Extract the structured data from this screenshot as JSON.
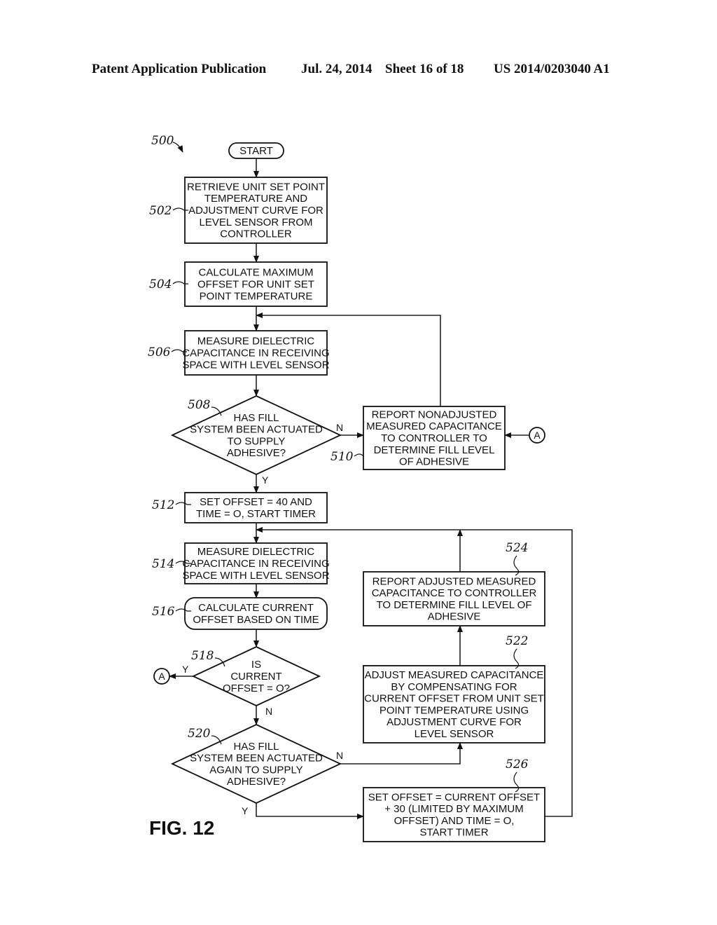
{
  "header": {
    "publication": "Patent Application Publication",
    "date": "Jul. 24, 2014",
    "sheet": "Sheet 16 of 18",
    "number": "US 2014/0203040 A1"
  },
  "figure": {
    "label": "FIG. 12",
    "ref": "500"
  },
  "nodes": [
    {
      "id": "start",
      "ref": "",
      "type": "terminal",
      "lines": [
        "START"
      ]
    },
    {
      "id": "502",
      "ref": "502",
      "type": "process",
      "lines": [
        "RETRIEVE UNIT SET POINT",
        "TEMPERATURE AND",
        "ADJUSTMENT CURVE FOR",
        "LEVEL SENSOR FROM",
        "CONTROLLER"
      ]
    },
    {
      "id": "504",
      "ref": "504",
      "type": "process",
      "lines": [
        "CALCULATE MAXIMUM",
        "OFFSET FOR UNIT SET",
        "POINT TEMPERATURE"
      ]
    },
    {
      "id": "506",
      "ref": "506",
      "type": "process",
      "lines": [
        "MEASURE DIELECTRIC",
        "CAPACITANCE IN RECEIVING",
        "SPACE WITH LEVEL SENSOR"
      ]
    },
    {
      "id": "508",
      "ref": "508",
      "type": "decision",
      "lines": [
        "HAS FILL",
        "SYSTEM BEEN ACTUATED",
        "TO SUPPLY",
        "ADHESIVE?"
      ]
    },
    {
      "id": "510",
      "ref": "510",
      "type": "process",
      "lines": [
        "REPORT  NONADJUSTED",
        "MEASURED CAPACITANCE",
        "TO CONTROLLER TO",
        "DETERMINE FILL LEVEL",
        "OF ADHESIVE"
      ]
    },
    {
      "id": "512",
      "ref": "512",
      "type": "process",
      "lines": [
        "SET OFFSET = 40 AND",
        "TIME = O, START TIMER"
      ]
    },
    {
      "id": "514",
      "ref": "514",
      "type": "process",
      "lines": [
        "MEASURE DIELECTRIC",
        "CAPACITANCE IN RECEIVING",
        "SPACE WITH LEVEL SENSOR"
      ]
    },
    {
      "id": "516",
      "ref": "516",
      "type": "rounded",
      "lines": [
        "CALCULATE CURRENT",
        "OFFSET BASED ON TIME"
      ]
    },
    {
      "id": "518",
      "ref": "518",
      "type": "decision",
      "lines": [
        "IS",
        "CURRENT",
        "OFFSET = O?"
      ]
    },
    {
      "id": "520",
      "ref": "520",
      "type": "decision",
      "lines": [
        "HAS FILL",
        "SYSTEM BEEN ACTUATED",
        "AGAIN TO SUPPLY",
        "ADHESIVE?"
      ]
    },
    {
      "id": "522",
      "ref": "522",
      "type": "process",
      "lines": [
        "ADJUST MEASURED CAPACITANCE",
        "BY COMPENSATING FOR",
        "CURRENT OFFSET FROM UNIT SET",
        "POINT TEMPERATURE USING",
        "ADJUSTMENT CURVE FOR",
        "LEVEL SENSOR"
      ]
    },
    {
      "id": "524",
      "ref": "524",
      "type": "process",
      "lines": [
        "REPORT ADJUSTED MEASURED",
        "CAPACITANCE TO CONTROLLER",
        "TO DETERMINE FILL LEVEL OF",
        "ADHESIVE"
      ]
    },
    {
      "id": "526",
      "ref": "526",
      "type": "process",
      "lines": [
        "SET OFFSET = CURRENT OFFSET",
        "+ 30 (LIMITED BY MAXIMUM",
        "OFFSET) AND TIME = O,",
        "START TIMER"
      ]
    }
  ],
  "branch_labels": {
    "508_no": "N",
    "508_yes": "Y",
    "518_yes": "Y",
    "518_no": "N",
    "520_no": "N",
    "520_yes": "Y"
  },
  "connector": "A"
}
